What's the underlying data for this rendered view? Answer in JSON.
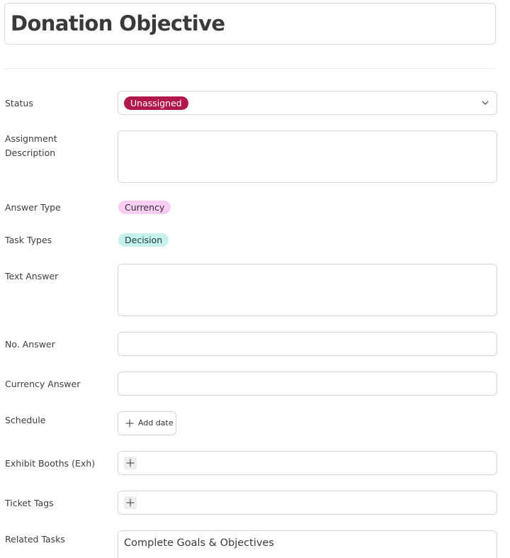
{
  "title": "Donation Objective",
  "fields": {
    "status": {
      "label": "Status",
      "value": "Unassigned",
      "color": "#b0174a"
    },
    "assignment_description": {
      "label_line1": "Assignment",
      "label_line2": "Description",
      "value": ""
    },
    "answer_type": {
      "label": "Answer Type",
      "value": "Currency",
      "color": "#f7cdf2"
    },
    "task_types": {
      "label": "Task Types",
      "value": "Decision",
      "color": "#c6f0ec"
    },
    "text_answer": {
      "label": "Text Answer",
      "value": ""
    },
    "no_answer": {
      "label": "No. Answer",
      "value": ""
    },
    "currency_answer": {
      "label": "Currency Answer",
      "value": ""
    },
    "schedule": {
      "label": "Schedule",
      "button_label": "Add date"
    },
    "exhibit_booths": {
      "label": "Exhibit Booths (Exh)"
    },
    "ticket_tags": {
      "label": "Ticket Tags"
    },
    "related_tasks": {
      "label": "Related Tasks",
      "value": "Complete Goals & Objectives"
    }
  },
  "icons": {
    "status_dropdown": "chevron-down-icon",
    "schedule_add": "plus-icon",
    "exhibit_booths_add": "plus-icon",
    "ticket_tags_add": "plus-icon"
  }
}
